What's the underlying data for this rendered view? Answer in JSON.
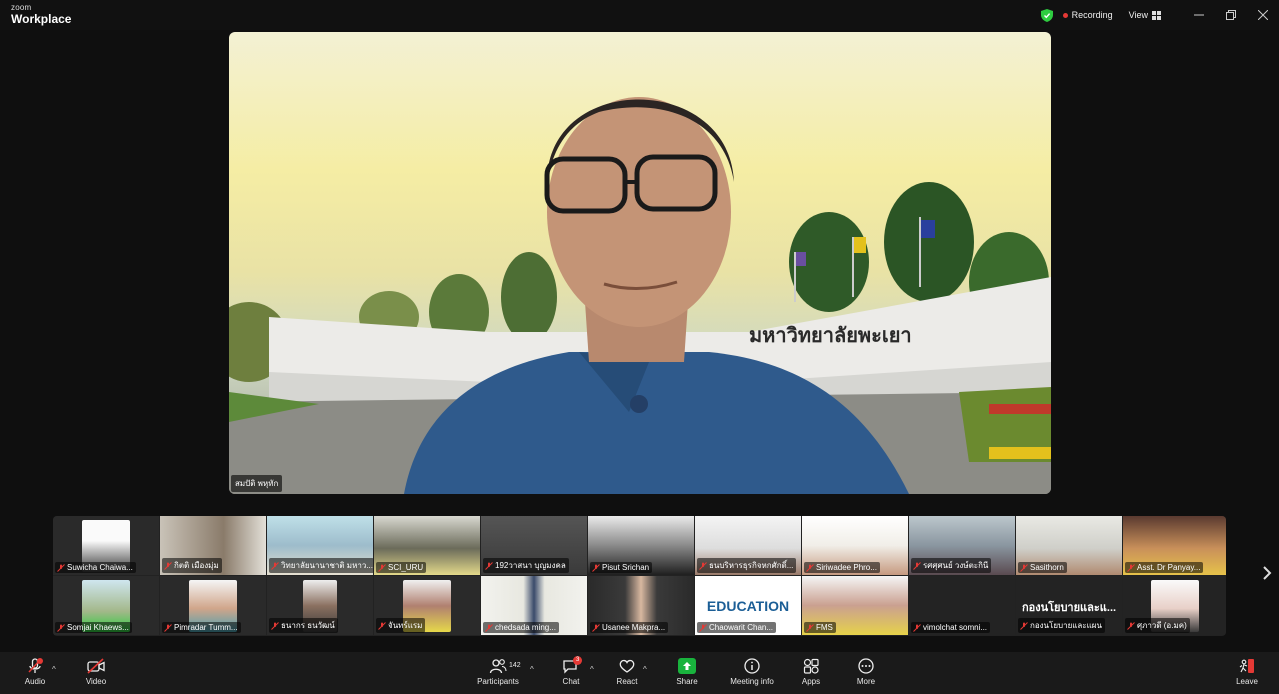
{
  "app": {
    "logo_top": "zoom",
    "logo_main": "Workplace"
  },
  "header": {
    "recording_label": "Recording",
    "view_label": "View"
  },
  "main_video": {
    "name": "สมปัติ พหุทัก",
    "sign_text": "มหาวิทยาลัยพะเยา"
  },
  "gallery": {
    "row1": [
      {
        "name": "Suwicha Chaiwa..."
      },
      {
        "name": "กิตติ เมืองมุ่ม"
      },
      {
        "name": "วิทยาลัยนานาชาติ มหาว..."
      },
      {
        "name": "SCI_URU"
      },
      {
        "name": "192วาสนา บุญมงคล"
      },
      {
        "name": "Pisut Srichan"
      },
      {
        "name": "ธนบริหารธุรกิจหกศักดิ์..."
      },
      {
        "name": "Siriwadee Phro..."
      },
      {
        "name": "รศศุศนย์ วงษ์ตะกินี"
      },
      {
        "name": "Sasithorn"
      },
      {
        "name": "Asst. Dr Panyay..."
      }
    ],
    "row2": [
      {
        "name": "Somjai Khaews..."
      },
      {
        "name": "Pimradar Tumm..."
      },
      {
        "name": "ธนากร ธนวัฒน์"
      },
      {
        "name": "จันทร์แรม"
      },
      {
        "name": "chedsada ming..."
      },
      {
        "name": "Usanee Makpra..."
      },
      {
        "name": "Chaowarit Chan...",
        "banner": "EDUCATION"
      },
      {
        "name": "FMS"
      },
      {
        "name": "vimolchat somni..."
      },
      {
        "name": "กองนโยบายและแผน",
        "display_text": "กองนโยบายและแ..."
      },
      {
        "name": "ศุภาวดี (อ.มค)"
      }
    ]
  },
  "toolbar": {
    "audio": "Audio",
    "video": "Video",
    "participants": "Participants",
    "participants_count": "142",
    "chat": "Chat",
    "chat_badge": "3",
    "react": "React",
    "share": "Share",
    "meeting_info": "Meeting info",
    "apps": "Apps",
    "more": "More",
    "leave": "Leave"
  },
  "colors": {
    "recording": "#e53935",
    "share": "#19b33d",
    "shield": "#2ecc40",
    "muted": "#e53935"
  }
}
